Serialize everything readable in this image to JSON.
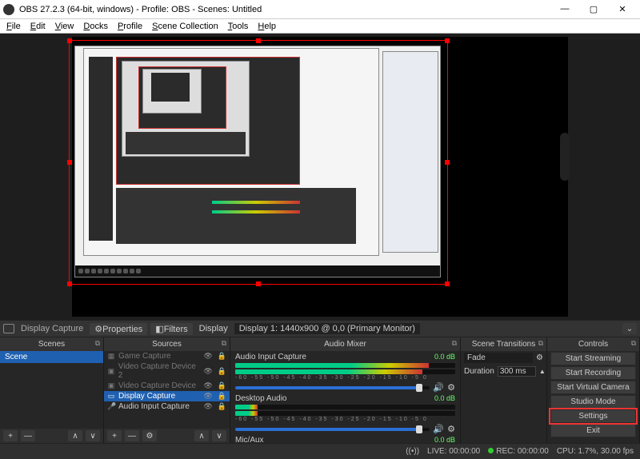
{
  "window": {
    "title": "OBS 27.2.3 (64-bit, windows) - Profile: OBS - Scenes: Untitled",
    "minimize": "—",
    "maximize": "▢",
    "close": "✕"
  },
  "menu": {
    "file": "File",
    "edit": "Edit",
    "view": "View",
    "docks": "Docks",
    "profile": "Profile",
    "scene_collection": "Scene Collection",
    "tools": "Tools",
    "help": "Help"
  },
  "context": {
    "source_name": "Display Capture",
    "properties": "Properties",
    "filters": "Filters",
    "display_label": "Display",
    "display_value": "Display 1: 1440x900 @ 0,0 (Primary Monitor)"
  },
  "panels": {
    "scenes": "Scenes",
    "sources": "Sources",
    "mixer": "Audio Mixer",
    "transitions": "Scene Transitions",
    "controls": "Controls"
  },
  "scenes_list": {
    "scene1": "Scene"
  },
  "sources_list": {
    "s1": "Game Capture",
    "s2": "Video Capture Device 2",
    "s3": "Video Capture Device",
    "s4": "Display Capture",
    "s5": "Audio Input Capture"
  },
  "mixer": {
    "track1": {
      "name": "Audio Input Capture",
      "db": "0.0 dB"
    },
    "track2": {
      "name": "Desktop Audio",
      "db": "0.0 dB"
    },
    "track3": {
      "name": "Mic/Aux",
      "db": "0.0 dB"
    },
    "ticks": "-60  -55  -50  -45  -40  -35  -30  -25  -20  -15  -10  -5  0"
  },
  "transitions": {
    "type": "Fade",
    "duration_label": "Duration",
    "duration_value": "300 ms"
  },
  "controls_btns": {
    "start_streaming": "Start Streaming",
    "start_recording": "Start Recording",
    "start_virtual_cam": "Start Virtual Camera",
    "studio_mode": "Studio Mode",
    "settings": "Settings",
    "exit": "Exit"
  },
  "status": {
    "live": "LIVE: 00:00:00",
    "rec": "REC: 00:00:00",
    "cpu": "CPU: 1.7%, 30.00 fps"
  },
  "icons": {
    "plus": "+",
    "minus": "—",
    "up": "∧",
    "down": "∨",
    "gear": "⚙",
    "eye": "👁",
    "lock": "🔒",
    "speaker": "🔊",
    "signal": "((•))",
    "dot": "●"
  }
}
